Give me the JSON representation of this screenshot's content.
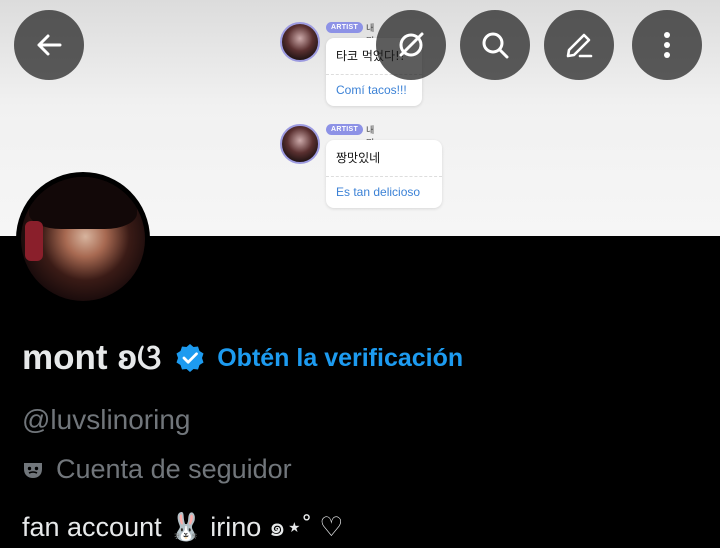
{
  "header": {
    "back_icon": "arrow-left-icon",
    "actions": [
      {
        "name": "grok-icon"
      },
      {
        "name": "search-icon"
      },
      {
        "name": "edit-pencil-icon"
      },
      {
        "name": "more-vertical-icon"
      }
    ]
  },
  "banner": {
    "messages": [
      {
        "badge": "ARTIST",
        "from": "내껴",
        "heart": "💛",
        "korean": "타코 먹었다!!",
        "translation": "Comí tacos!!!"
      },
      {
        "badge": "ARTIST",
        "from": "내껴",
        "heart": "💛",
        "korean": "짱맛있네",
        "translation": "Es tan delicioso"
      }
    ]
  },
  "profile": {
    "display_name": "mont ʚଓ",
    "get_verified": "Obtén la verificación",
    "handle": "@luvslinoring",
    "account_type": "Cuenta de seguidor",
    "bio": "fan account 🐰 irino ๑⋆˚ ♡"
  },
  "colors": {
    "background": "#000000",
    "accent": "#1d9bf0",
    "secondary_text": "#71767b",
    "primary_text": "#e7e9ea"
  }
}
